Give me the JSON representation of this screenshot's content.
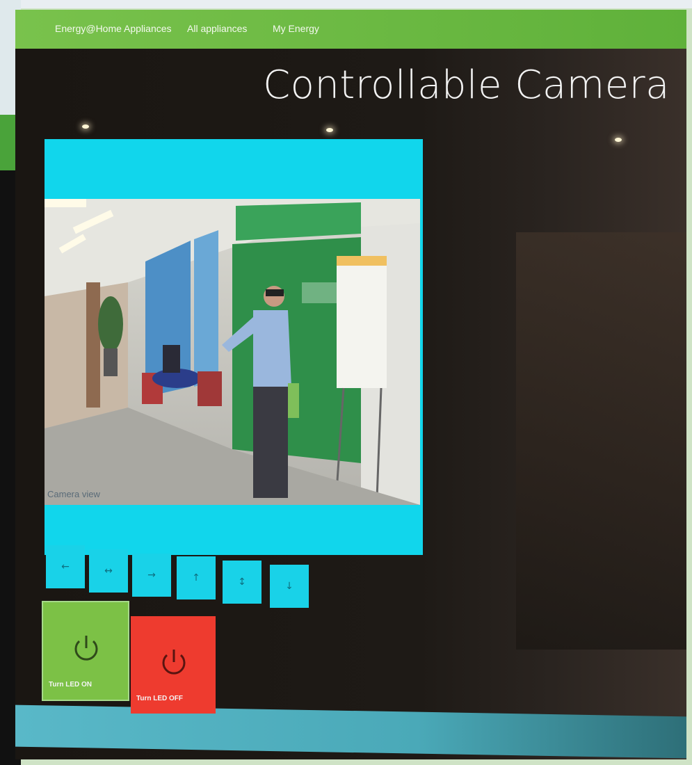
{
  "nav": {
    "items": [
      {
        "label": "Energy@Home Appliances"
      },
      {
        "label": "All appliances"
      },
      {
        "label": "My Energy"
      }
    ]
  },
  "page": {
    "title": "Controllable Camera"
  },
  "camera": {
    "caption": "Camera view"
  },
  "controls": {
    "directions": [
      {
        "icon": "arrow-left-icon",
        "glyph": "←"
      },
      {
        "icon": "arrow-left-right-icon",
        "glyph": "↔"
      },
      {
        "icon": "arrow-right-icon",
        "glyph": "→"
      },
      {
        "icon": "arrow-up-icon",
        "glyph": "↑"
      },
      {
        "icon": "arrow-up-down-icon",
        "glyph": "↕"
      },
      {
        "icon": "arrow-down-icon",
        "glyph": "↓"
      }
    ]
  },
  "led": {
    "on_label": "Turn LED ON",
    "off_label": "Turn LED OFF"
  },
  "colors": {
    "topbar": "#6cbb43",
    "camera_panel": "#11d6ec",
    "led_on": "#7cc146",
    "led_off": "#ee3b2f"
  }
}
